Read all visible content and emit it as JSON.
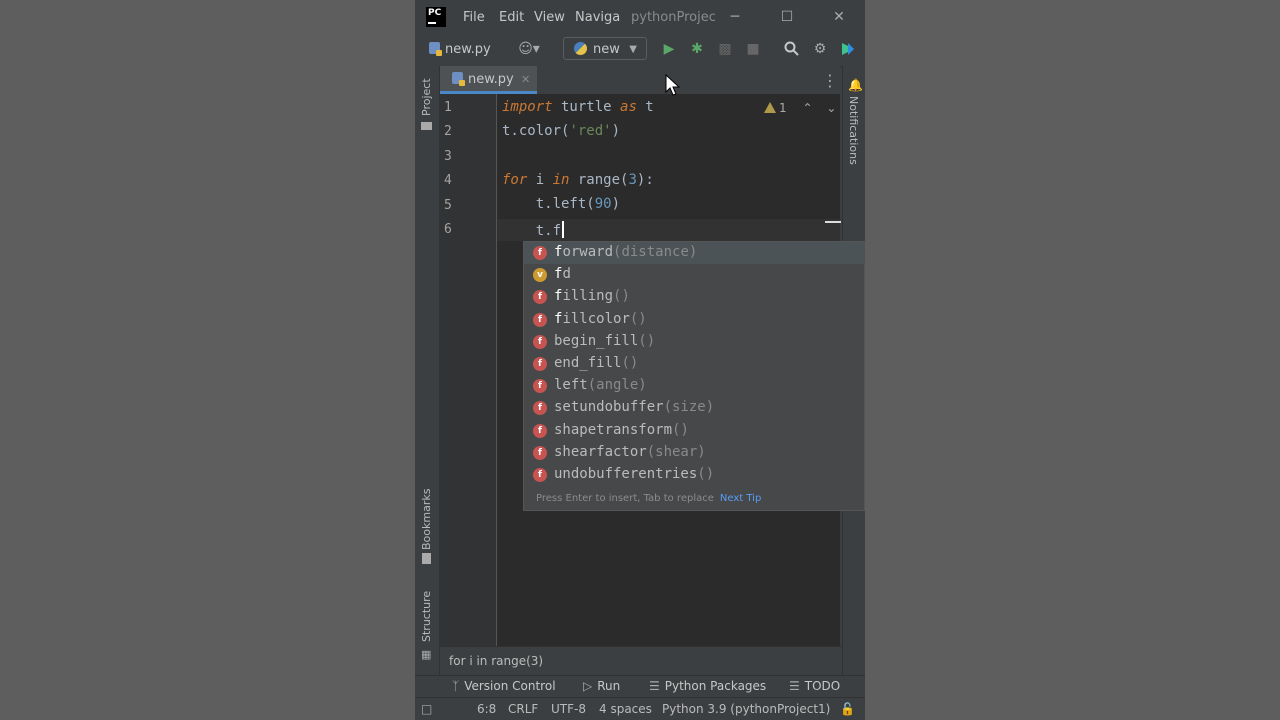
{
  "titlebar": {
    "menus": [
      "File",
      "Edit",
      "View",
      "Naviga"
    ],
    "project_title": "pythonProjec",
    "minimize": "─",
    "maximize": "☐",
    "close": "✕"
  },
  "toolbar": {
    "file_label": "new.py",
    "run_config": "new"
  },
  "tab": {
    "label": "new.py",
    "close": "✕"
  },
  "left_stripe": {
    "project": "Project",
    "bookmarks": "Bookmarks",
    "structure": "Structure"
  },
  "right_stripe": {
    "notifications": "Notifications"
  },
  "editor": {
    "line_numbers": [
      "1",
      "2",
      "3",
      "4",
      "5",
      "6"
    ],
    "inspection_count": "1"
  },
  "completion": {
    "items": [
      {
        "kind": "f",
        "match": "f",
        "rest": "orward",
        "params": "(distance)"
      },
      {
        "kind": "v",
        "match": "f",
        "rest": "d",
        "params": ""
      },
      {
        "kind": "f",
        "match": "f",
        "rest": "illing",
        "params": "()"
      },
      {
        "kind": "f",
        "match": "f",
        "rest": "illcolor",
        "params": "()"
      },
      {
        "kind": "f",
        "match": "",
        "rest": "begin_fill",
        "params": "()"
      },
      {
        "kind": "f",
        "match": "",
        "rest": "end_fill",
        "params": "()"
      },
      {
        "kind": "f",
        "match": "",
        "rest": "left",
        "params": "(angle)"
      },
      {
        "kind": "f",
        "match": "",
        "rest": "setundobuffer",
        "params": "(size)"
      },
      {
        "kind": "f",
        "match": "",
        "rest": "shapetransform",
        "params": "()"
      },
      {
        "kind": "f",
        "match": "",
        "rest": "shearfactor",
        "params": "(shear)"
      },
      {
        "kind": "f",
        "match": "",
        "rest": "undobufferentries",
        "params": "()"
      }
    ],
    "hint": "Press Enter to insert, Tab to replace",
    "next_tip": "Next Tip"
  },
  "breadcrumb": "for i in range(3)",
  "tooltabs": {
    "version_control": "Version Control",
    "run": "Run",
    "python_packages": "Python Packages",
    "todo": "TODO"
  },
  "statusbar": {
    "position": "6:8",
    "line_sep": "CRLF",
    "encoding": "UTF-8",
    "indent": "4 spaces",
    "interpreter": "Python 3.9 (pythonProject1)"
  }
}
